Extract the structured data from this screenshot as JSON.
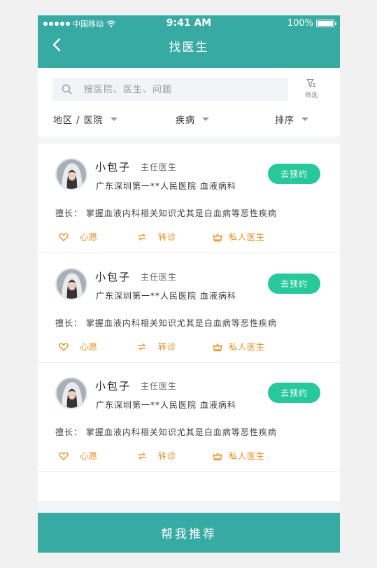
{
  "status_bar": {
    "carrier": "中国移动",
    "time": "9:41 AM",
    "battery": "100%"
  },
  "header": {
    "title": "找医生",
    "back_icon": "chevron-left-icon"
  },
  "search": {
    "placeholder": "搜医院、医生、问题",
    "filter_label": "筛选"
  },
  "tabs": [
    {
      "label": "地区 / 医院"
    },
    {
      "label": "疾病"
    },
    {
      "label": "排序"
    }
  ],
  "doctors": [
    {
      "name": "小包子",
      "title": "主任医生",
      "hospital": "广东深圳第一**人民医院  血液病科",
      "book_label": "去预约",
      "skill": "擅长： 掌握血液内科相关知识尤其是白血病等恶性疾病",
      "wish_label": "心愿",
      "transfer_label": "转诊",
      "private_label": "私人医生"
    },
    {
      "name": "小包子",
      "title": "主任医生",
      "hospital": "广东深圳第一**人民医院  血液病科",
      "book_label": "去预约",
      "skill": "擅长： 掌握血液内科相关知识尤其是白血病等恶性疾病",
      "wish_label": "心愿",
      "transfer_label": "转诊",
      "private_label": "私人医生"
    },
    {
      "name": "小包子",
      "title": "主任医生",
      "hospital": "广东深圳第一**人民医院  血液病科",
      "book_label": "去预约",
      "skill": "擅长： 掌握血液内科相关知识尤其是白血病等恶性疾病",
      "wish_label": "心愿",
      "transfer_label": "转诊",
      "private_label": "私人医生"
    }
  ],
  "bottom_button": {
    "label": "帮我推荐"
  },
  "colors": {
    "primary": "#37aaa3",
    "accent_green": "#27c99c",
    "accent_orange": "#e98a1a"
  }
}
